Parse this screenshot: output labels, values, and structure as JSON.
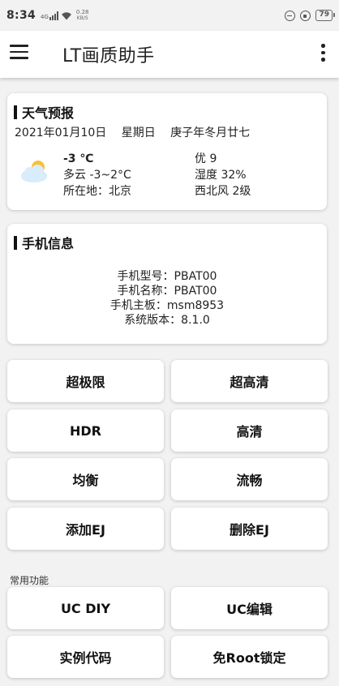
{
  "status_bar": {
    "time": "8:34",
    "network_type": "4G",
    "speed_value": "0.28",
    "speed_unit": "KB/S",
    "battery": "79",
    "icons": [
      "signal-icon",
      "wifi-icon",
      "data-saver-icon",
      "vpn-lock-icon",
      "battery-icon"
    ]
  },
  "app_bar": {
    "title": "LT画质助手",
    "menu_icon": "hamburger-menu-icon",
    "overflow_icon": "more-vert-icon"
  },
  "weather": {
    "header": "天气预报",
    "date": "2021年01月10日",
    "weekday": "星期日",
    "lunar": "庚子年冬月廿七",
    "icon": "cloudy-sun-icon",
    "temperature": "-3 ℃",
    "condition": "多云 -3~2°C",
    "location": "所在地：北京",
    "air_quality": "优 9",
    "humidity": "湿度 32%",
    "wind": "西北风 2级"
  },
  "phone": {
    "header": "手机信息",
    "model": "手机型号：PBAT00",
    "name": "手机名称：PBAT00",
    "board": "手机主板：msm8953",
    "version": "系统版本：8.1.0"
  },
  "modes": {
    "btn_1": "超极限",
    "btn_2": "超高清",
    "btn_3": "HDR",
    "btn_4": "高清",
    "btn_5": "均衡",
    "btn_6": "流畅",
    "btn_7": "添加EJ",
    "btn_8": "删除EJ"
  },
  "common": {
    "label": "常用功能",
    "btn_1": "UC DIY",
    "btn_2": "UC编辑",
    "btn_3": "实例代码",
    "btn_4": "免Root锁定"
  },
  "colors": {
    "background": "#f2f2f2",
    "card": "#ffffff",
    "text": "#222222",
    "cloud": "#cfe6f7",
    "sun": "#f6c23a"
  }
}
